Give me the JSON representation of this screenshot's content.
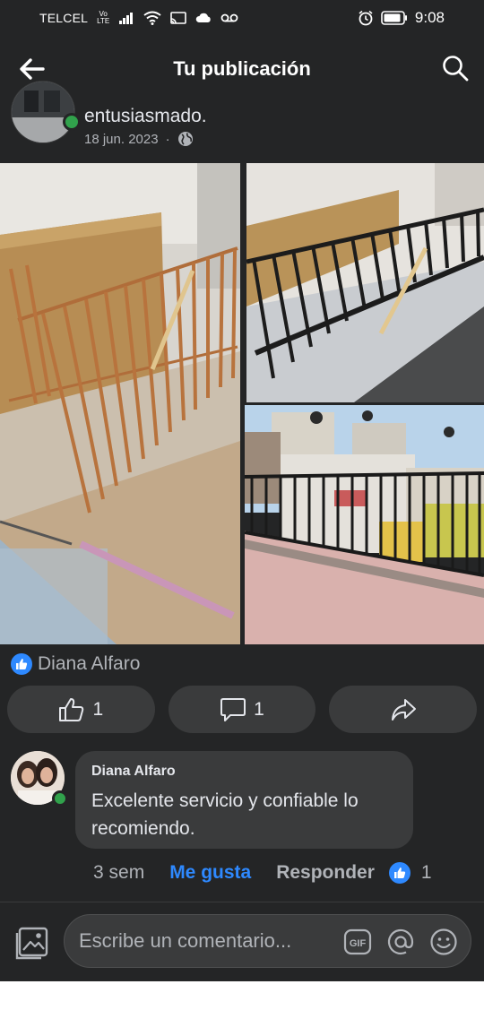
{
  "status_bar": {
    "carrier": "TELCEL",
    "volte_top": "Vo",
    "volte_bottom": "LTE",
    "time": "9:08",
    "icons": [
      "signal-icon",
      "wifi-icon",
      "cast-icon",
      "cloud-icon",
      "voicemail-icon",
      "alarm-icon",
      "battery-icon"
    ]
  },
  "header": {
    "title": "Tu publicación",
    "back_icon": "arrow-left-icon",
    "search_icon": "search-icon"
  },
  "post": {
    "author": "entusiasmado.",
    "date": "18 jun. 2023",
    "separator": "·",
    "audience_icon": "globe-icon",
    "photos": [
      "photo-railing-installation",
      "photo-painted-railing",
      "photo-rooftop-railing"
    ]
  },
  "reactions": {
    "icon": "like-badge-icon",
    "name": "Diana Alfaro"
  },
  "actions": {
    "like_count": "1",
    "comment_count": "1"
  },
  "comment": {
    "author": "Diana Alfaro",
    "text": "Excelente servicio y confiable lo recomiendo.",
    "time": "3 sem",
    "like_label": "Me gusta",
    "reply_label": "Responder",
    "like_count": "1"
  },
  "composer": {
    "placeholder": "Escribe un comentario...",
    "icons": [
      "gallery-icon",
      "gif-icon",
      "mention-icon",
      "emoji-icon"
    ]
  },
  "colors": {
    "background": "#242526",
    "surface": "#3a3b3c",
    "accent": "#2e89ff",
    "online": "#31a24c"
  }
}
